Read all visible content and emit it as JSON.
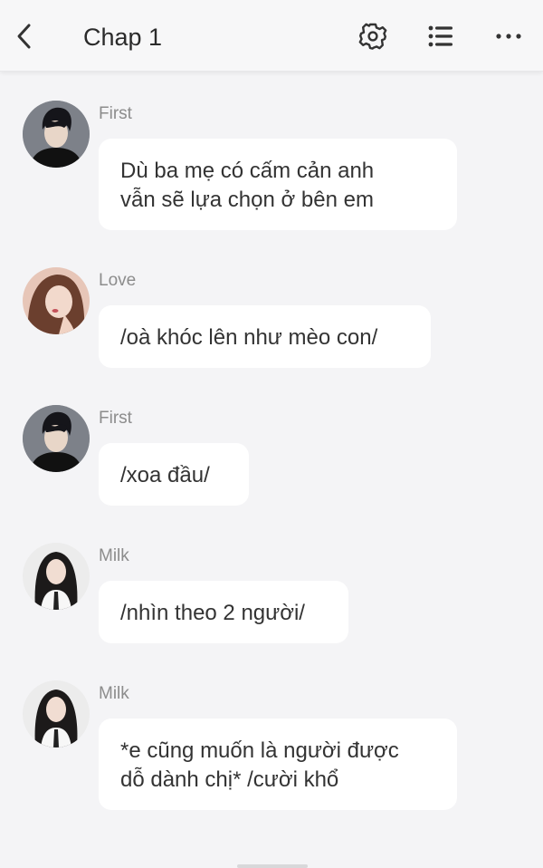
{
  "header": {
    "title": "Chap 1",
    "back_icon": "chevron-left-icon",
    "settings_icon": "gear-icon",
    "list_icon": "list-icon",
    "more_icon": "more-horizontal-icon"
  },
  "messages": [
    {
      "sender": "First",
      "lines": [
        "Dù ba mẹ có cấm cản anh",
        "vẫn sẽ lựa chọn ở bên em"
      ]
    },
    {
      "sender": "Love",
      "lines": [
        "/oà khóc lên như mèo con/"
      ]
    },
    {
      "sender": "First",
      "lines": [
        "/xoa đầu/"
      ]
    },
    {
      "sender": "Milk",
      "lines": [
        "/nhìn theo 2 người/"
      ]
    },
    {
      "sender": "Milk",
      "lines": [
        "*e cũng muốn là người được",
        "dỗ dành chị* /cười khổ"
      ]
    }
  ],
  "colors": {
    "background": "#f4f4f6",
    "header_bg": "#f7f7f8",
    "bubble_bg": "#ffffff",
    "sender_text": "#8c8c8c",
    "message_text": "#333333"
  }
}
